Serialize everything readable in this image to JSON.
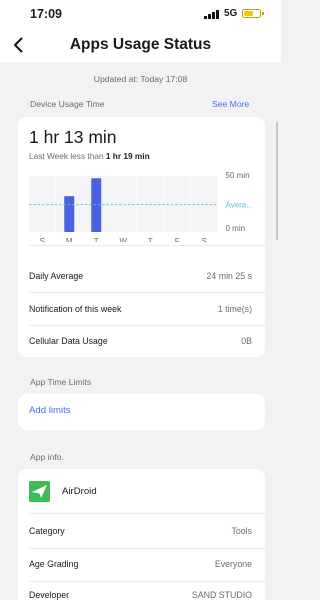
{
  "status_bar": {
    "time": "17:09",
    "network": "5G",
    "battery_level": 0.5
  },
  "nav": {
    "title": "Apps Usage Status",
    "back_icon": "chevron-left-icon"
  },
  "updated": "Updated at: Today 17:08",
  "device_usage": {
    "heading": "Device Usage Time",
    "see_more": "See More",
    "total": "1 hr 13 min",
    "last_week_prefix": "Last Week less than",
    "last_week_value": "1 hr 19 min"
  },
  "chart_data": {
    "type": "bar",
    "categories": [
      "S",
      "M",
      "T",
      "W",
      "T",
      "F",
      "S"
    ],
    "values": [
      0,
      32,
      48,
      0,
      0,
      0,
      0
    ],
    "yticks": [
      "50 min",
      "0 min"
    ],
    "ylim": [
      0,
      50
    ],
    "average_label": "Avera...",
    "average": 24.4,
    "colors": {
      "bar": "#4a62e0",
      "avg_line": "#5bc0d8",
      "col_bg": "#f4f4f6"
    }
  },
  "stats": [
    {
      "label": "Daily Average",
      "value": "24 min 25 s"
    },
    {
      "label": "Notification of this week",
      "value": "1 time(s)"
    },
    {
      "label": "Cellular Data Usage",
      "value": "0B"
    }
  ],
  "time_limits": {
    "heading": "App Time Limits",
    "add_label": "Add limits"
  },
  "app_info": {
    "heading": "App info.",
    "name": "AirDroid",
    "icon": "airdroid-logo",
    "rows": [
      {
        "label": "Category",
        "value": "Tools"
      },
      {
        "label": "Age Grading",
        "value": "Everyone"
      },
      {
        "label": "Developer",
        "value": "SAND STUDIO"
      }
    ]
  },
  "colors": {
    "accent": "#4a6ef5",
    "background": "#f2f2f4",
    "card": "#ffffff"
  }
}
